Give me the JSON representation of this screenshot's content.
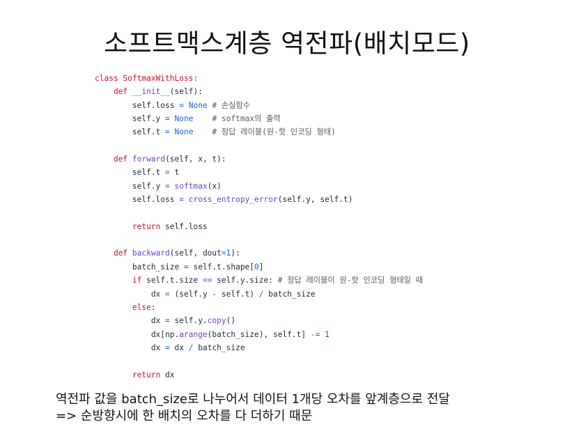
{
  "title": "소프트맥스계층 역전파(배치모드)",
  "code_lines": [
    [
      {
        "t": "class ",
        "c": "kw"
      },
      {
        "t": "SoftmaxWithLoss:",
        "c": "kw"
      }
    ],
    [
      {
        "t": "    "
      },
      {
        "t": "def ",
        "c": "kw"
      },
      {
        "t": "__init__",
        "c": "fn"
      },
      {
        "t": "(self):"
      }
    ],
    [
      {
        "t": "        self.loss "
      },
      {
        "t": "=",
        "c": "op"
      },
      {
        "t": " "
      },
      {
        "t": "None",
        "c": "const"
      },
      {
        "t": " # 손실함수",
        "c": "comment"
      }
    ],
    [
      {
        "t": "        self.y "
      },
      {
        "t": "=",
        "c": "op"
      },
      {
        "t": " "
      },
      {
        "t": "None",
        "c": "const"
      },
      {
        "t": "    # softmax의 출력",
        "c": "comment"
      }
    ],
    [
      {
        "t": "        self.t "
      },
      {
        "t": "=",
        "c": "op"
      },
      {
        "t": " "
      },
      {
        "t": "None",
        "c": "const"
      },
      {
        "t": "    # 정답 레이블(원-핫 인코딩 형태)",
        "c": "comment"
      }
    ],
    [
      {
        "t": ""
      }
    ],
    [
      {
        "t": "    "
      },
      {
        "t": "def ",
        "c": "kw"
      },
      {
        "t": "forward",
        "c": "fn"
      },
      {
        "t": "(self, x, t):"
      }
    ],
    [
      {
        "t": "        self.t "
      },
      {
        "t": "=",
        "c": "op"
      },
      {
        "t": " t"
      }
    ],
    [
      {
        "t": "        self.y "
      },
      {
        "t": "=",
        "c": "op"
      },
      {
        "t": " "
      },
      {
        "t": "softmax",
        "c": "fn"
      },
      {
        "t": "(x)"
      }
    ],
    [
      {
        "t": "        self.loss "
      },
      {
        "t": "=",
        "c": "op"
      },
      {
        "t": " "
      },
      {
        "t": "cross_entropy_error",
        "c": "fn"
      },
      {
        "t": "(self.y, self.t)"
      }
    ],
    [
      {
        "t": ""
      }
    ],
    [
      {
        "t": "        "
      },
      {
        "t": "return",
        "c": "kw"
      },
      {
        "t": " self.loss"
      }
    ],
    [
      {
        "t": ""
      }
    ],
    [
      {
        "t": "    "
      },
      {
        "t": "def ",
        "c": "kw"
      },
      {
        "t": "backward",
        "c": "fn"
      },
      {
        "t": "(self, dout"
      },
      {
        "t": "=",
        "c": "op"
      },
      {
        "t": "1",
        "c": "num"
      },
      {
        "t": "):"
      }
    ],
    [
      {
        "t": "        batch_size "
      },
      {
        "t": "=",
        "c": "op"
      },
      {
        "t": " self.t.shape["
      },
      {
        "t": "0",
        "c": "num"
      },
      {
        "t": "]"
      }
    ],
    [
      {
        "t": "        "
      },
      {
        "t": "if",
        "c": "kw"
      },
      {
        "t": " self.t.size "
      },
      {
        "t": "==",
        "c": "op"
      },
      {
        "t": " self.y.size: "
      },
      {
        "t": "# 정답 레이블이 원-핫 인코딩 형태일 때",
        "c": "comment"
      }
    ],
    [
      {
        "t": "            dx "
      },
      {
        "t": "=",
        "c": "op"
      },
      {
        "t": " (self.y "
      },
      {
        "t": "-",
        "c": "op"
      },
      {
        "t": " self.t) "
      },
      {
        "t": "/",
        "c": "op"
      },
      {
        "t": " batch_size"
      }
    ],
    [
      {
        "t": "        "
      },
      {
        "t": "else",
        "c": "kw"
      },
      {
        "t": ":"
      }
    ],
    [
      {
        "t": "            dx "
      },
      {
        "t": "=",
        "c": "op"
      },
      {
        "t": " self.y."
      },
      {
        "t": "copy",
        "c": "fn"
      },
      {
        "t": "()"
      }
    ],
    [
      {
        "t": "            dx[np."
      },
      {
        "t": "arange",
        "c": "fn"
      },
      {
        "t": "(batch_size), self.t] "
      },
      {
        "t": "-=",
        "c": "op"
      },
      {
        "t": " "
      },
      {
        "t": "1",
        "c": "num"
      }
    ],
    [
      {
        "t": "            dx "
      },
      {
        "t": "=",
        "c": "op"
      },
      {
        "t": " dx "
      },
      {
        "t": "/",
        "c": "op"
      },
      {
        "t": " batch_size"
      }
    ],
    [
      {
        "t": ""
      }
    ],
    [
      {
        "t": "        "
      },
      {
        "t": "return",
        "c": "kw"
      },
      {
        "t": " dx"
      }
    ]
  ],
  "note": {
    "line1": "역전파 값을 batch_size로 나누어서 데이터 1개당 오차를 앞계층으로 전달",
    "line2": "=> 순방향시에 한 배치의 오차를 다 더하기 때문"
  },
  "colors": {
    "keyword": "#c8102e",
    "function": "#6f42c1",
    "constant": "#1d5fd6",
    "comment": "#5a5a5a",
    "text": "#1f2937"
  }
}
